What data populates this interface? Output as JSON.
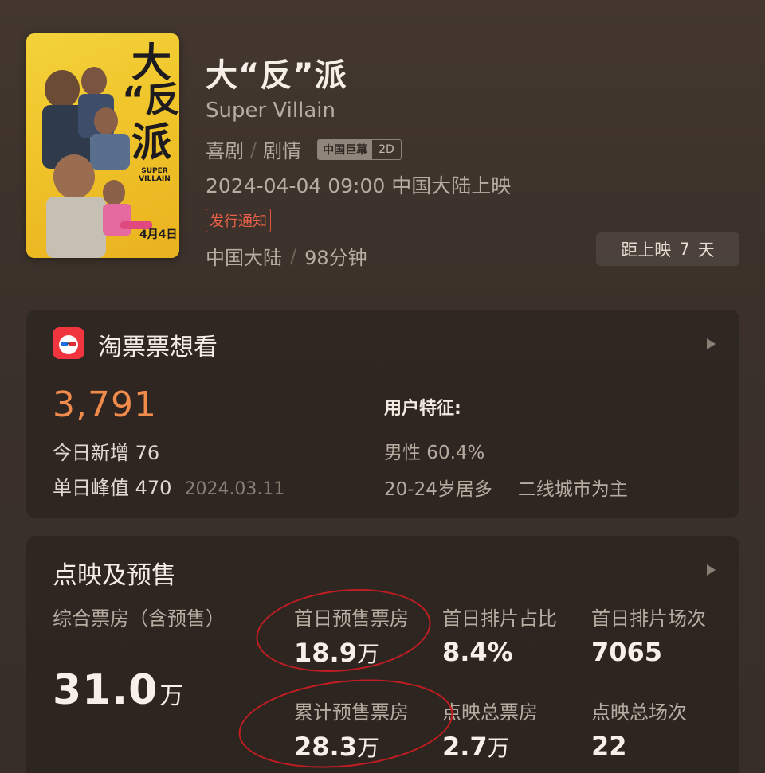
{
  "movie": {
    "title": "大“反”派",
    "subtitle": "Super Villain",
    "genres": [
      "喜剧",
      "剧情"
    ],
    "badges": {
      "format": "中国巨幕",
      "dimension": "2D"
    },
    "release": "2024-04-04 09:00 中国大陆上映",
    "notice_button": "发行通知",
    "region": "中国大陆",
    "duration": "98分钟",
    "countdown": {
      "prefix": "距上映",
      "days": "7",
      "suffix": "天"
    },
    "poster": {
      "title_line1": "大",
      "title_line2": "“反”",
      "title_line3": "派",
      "en": "SUPER VILLAIN",
      "date": "4月4日"
    }
  },
  "want_to_see": {
    "title": "淘票票想看",
    "count": "3,791",
    "today_label": "今日新增",
    "today_value": "76",
    "peak_label": "单日峰值",
    "peak_value": "470",
    "peak_date": "2024.03.11",
    "features_title": "用户特征:",
    "gender": "男性 60.4%",
    "age": "20-24岁居多",
    "city": "二线城市为主"
  },
  "presale": {
    "title": "点映及预售",
    "combined_label": "综合票房（含预售）",
    "combined_value": "31.0",
    "combined_unit": "万",
    "stats": [
      {
        "label": "首日预售票房",
        "value": "18.9",
        "unit": "万"
      },
      {
        "label": "首日排片占比",
        "value": "8.4%",
        "unit": ""
      },
      {
        "label": "首日排片场次",
        "value": "7065",
        "unit": ""
      },
      {
        "label": "累计预售票房",
        "value": "28.3",
        "unit": "万"
      },
      {
        "label": "点映总票房",
        "value": "2.7",
        "unit": "万"
      },
      {
        "label": "点映总场次",
        "value": "22",
        "unit": ""
      }
    ]
  },
  "colors": {
    "accent": "#f08b4c",
    "notice": "#e8604a",
    "annotation": "#c21d22",
    "logo": "#f0353f"
  }
}
